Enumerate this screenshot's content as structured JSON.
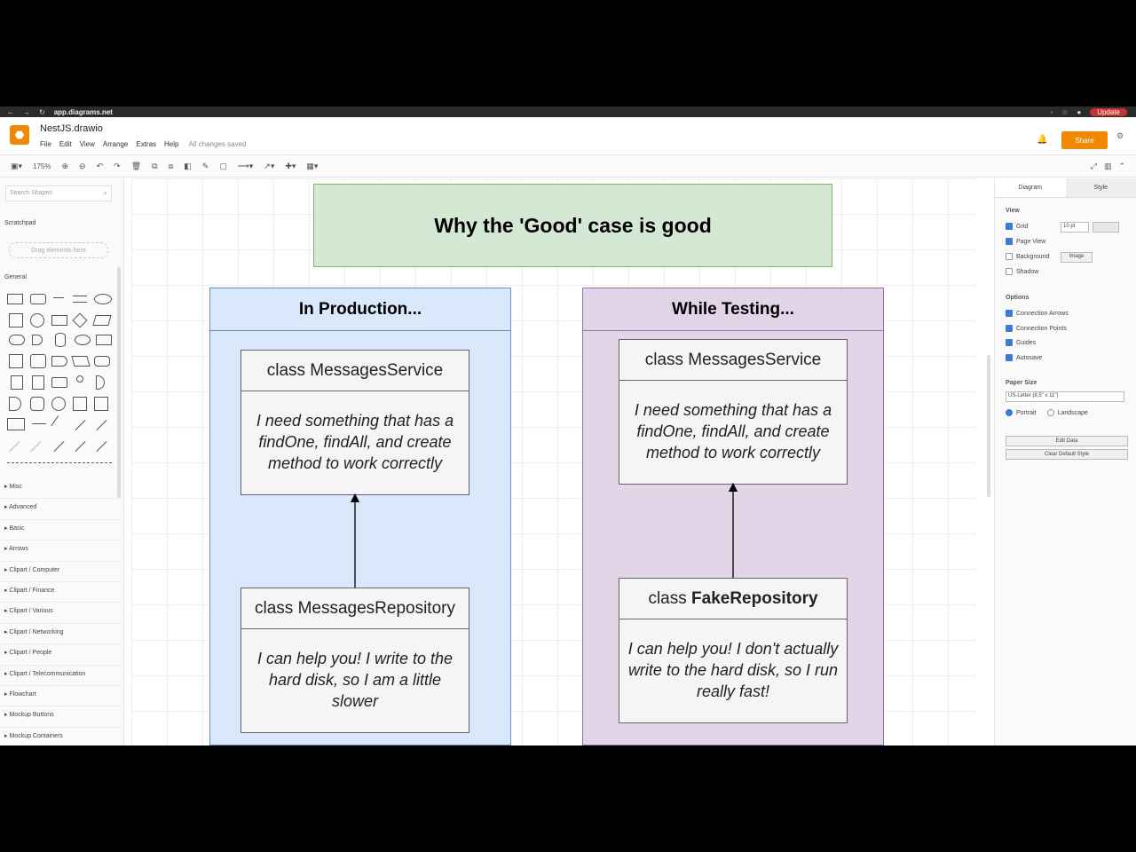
{
  "browser": {
    "url": "app.diagrams.net",
    "update": "Update"
  },
  "app": {
    "file_name": "NestJS.drawio",
    "saved_status": "All changes saved",
    "share_label": "Share"
  },
  "menu": [
    "File",
    "Edit",
    "View",
    "Arrange",
    "Extras",
    "Help"
  ],
  "toolbar": {
    "zoom": "175%"
  },
  "left_panel": {
    "search_placeholder": "Search Shapes",
    "scratchpad": "Scratchpad",
    "drag_here": "Drag elements here",
    "general": "General",
    "libraries": [
      "Misc",
      "Advanced",
      "Basic",
      "Arrows",
      "Clipart / Computer",
      "Clipart / Finance",
      "Clipart / Various",
      "Clipart / Networking",
      "Clipart / People",
      "Clipart / Telecommunication",
      "Flowchart",
      "Mockup Buttons",
      "Mockup Containers"
    ]
  },
  "canvas": {
    "title": "Why the 'Good' case is good",
    "production": {
      "heading": "In Production...",
      "service_title": "class MessagesService",
      "service_body": "I need something that has a findOne, findAll, and create method to work correctly",
      "repo_title": "class MessagesRepository",
      "repo_body": "I can help you! I write to the hard disk, so I am a little slower"
    },
    "testing": {
      "heading": "While Testing...",
      "service_title": "class MessagesService",
      "service_body": "I need something that has a findOne, findAll, and create method to work correctly",
      "repo_prefix": "class ",
      "repo_name": "FakeRepository",
      "repo_body": "I can help you! I don't actually write to the hard disk, so I run really fast!"
    }
  },
  "right_panel": {
    "tabs": [
      "Diagram",
      "Style"
    ],
    "view_label": "View",
    "grid": "Grid",
    "grid_size": "10 pt",
    "page_view": "Page View",
    "background": "Background",
    "image_btn": "Image",
    "shadow": "Shadow",
    "options_label": "Options",
    "connection_arrows": "Connection Arrows",
    "connection_points": "Connection Points",
    "guides": "Guides",
    "autosave": "Autosave",
    "paper_size_label": "Paper Size",
    "paper_size": "US-Letter (8,5\" x 11\")",
    "portrait": "Portrait",
    "landscape": "Landscape",
    "edit_data": "Edit Data",
    "clear_default_style": "Clear Default Style"
  },
  "colors": {
    "title_fill": "#d5e8d4",
    "production_fill": "#dae8fc",
    "testing_fill": "#e1d5e7",
    "class_fill": "#f5f5f5",
    "accent": "#f08705"
  }
}
